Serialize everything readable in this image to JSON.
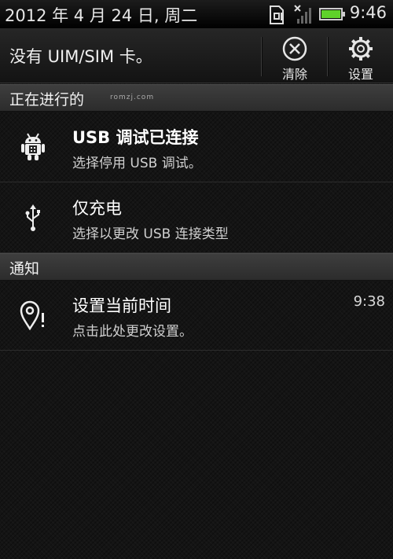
{
  "status_bar": {
    "date": "2012 年 4 月 24 日, 周二",
    "time": "9:46",
    "icons": [
      "sim-card-icon",
      "no-signal-icon",
      "battery-icon"
    ]
  },
  "header": {
    "carrier_text": "没有 UIM/SIM 卡。",
    "clear_label": "清除",
    "settings_label": "设置",
    "icons": [
      "clear-icon",
      "gear-icon"
    ]
  },
  "ongoing": {
    "title": "正在进行的",
    "watermark": "romzj.com",
    "items": [
      {
        "title": "USB 调试已连接",
        "subtitle": "选择停用 USB 调试。",
        "icon": "android-debug-icon"
      },
      {
        "title": "仅充电",
        "subtitle": "选择以更改 USB 连接类型",
        "icon": "usb-icon"
      }
    ]
  },
  "notifications": {
    "title": "通知",
    "items": [
      {
        "title": "设置当前时间",
        "subtitle": "点击此处更改设置。",
        "time": "9:38",
        "icon": "location-alert-icon"
      }
    ]
  },
  "colors": {
    "background": "#141414",
    "section_bg": "#353535",
    "battery_green": "#5fd12a"
  }
}
